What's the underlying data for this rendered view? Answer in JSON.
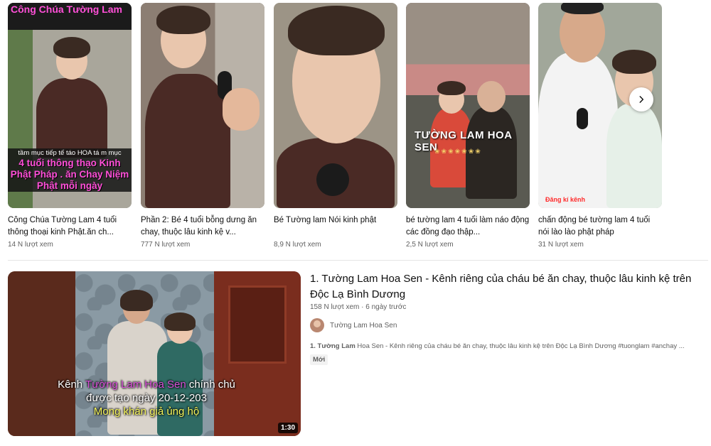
{
  "shorts": [
    {
      "title": "Công Chúa Tường Lam 4 tuổi thông thoại kinh Phật.ăn ch...",
      "views": "14 N lượt xem",
      "overlay_top": "Công Chúa Tường Lam",
      "overlay_small": "tầm mục tiếp tế táo HOA tá m mục",
      "overlay_big": "4 tuổi thông thạo Kinh Phật Pháp . ăn Chay Niệm Phật mỗi ngày"
    },
    {
      "title": "Phần 2: Bé 4 tuổi bỗng dưng ăn chay, thuộc lâu kinh kệ v...",
      "views": "777 N lượt xem"
    },
    {
      "title": "Bé Tường lam Nói kinh phật",
      "views": "8,9 N lượt xem"
    },
    {
      "title": "bé tường lam 4 tuổi làm náo động các đồng đạo thập...",
      "views": "2,5 N lượt xem",
      "overlay_text": "TƯỜNG LAM HOA SEN"
    },
    {
      "title": "chấn động bé tường lam 4 tuổi nói lào lào phật pháp",
      "views": "31 N lượt xem",
      "overlay_tag": "Đăng kí kênh"
    }
  ],
  "video": {
    "title": "1. Tường Lam Hoa Sen - Kênh riêng của cháu bé ăn chay, thuộc lâu kinh kệ trên Độc Lạ Bình Dương",
    "meta": "158 N lượt xem · 6 ngày trước",
    "channel": "Tường Lam Hoa Sen",
    "desc_bold": "1. Tường Lam",
    "desc_rest": " Hoa Sen - Kênh riêng của cháu bé ăn chay, thuộc lâu kinh kệ trên Độc Lạ Bình Dương #tuonglam #anchay ...",
    "badge": "Mới",
    "duration": "1:30",
    "caption_1a": "Kênh ",
    "caption_1b": "Tường Lam Hoa Sen",
    "caption_1c": " chính chủ",
    "caption_2": "được tạo ngày 20-12-203",
    "caption_3": "Mong khán giả ủng hộ"
  },
  "icons": {
    "next": "chevron-right-icon"
  }
}
